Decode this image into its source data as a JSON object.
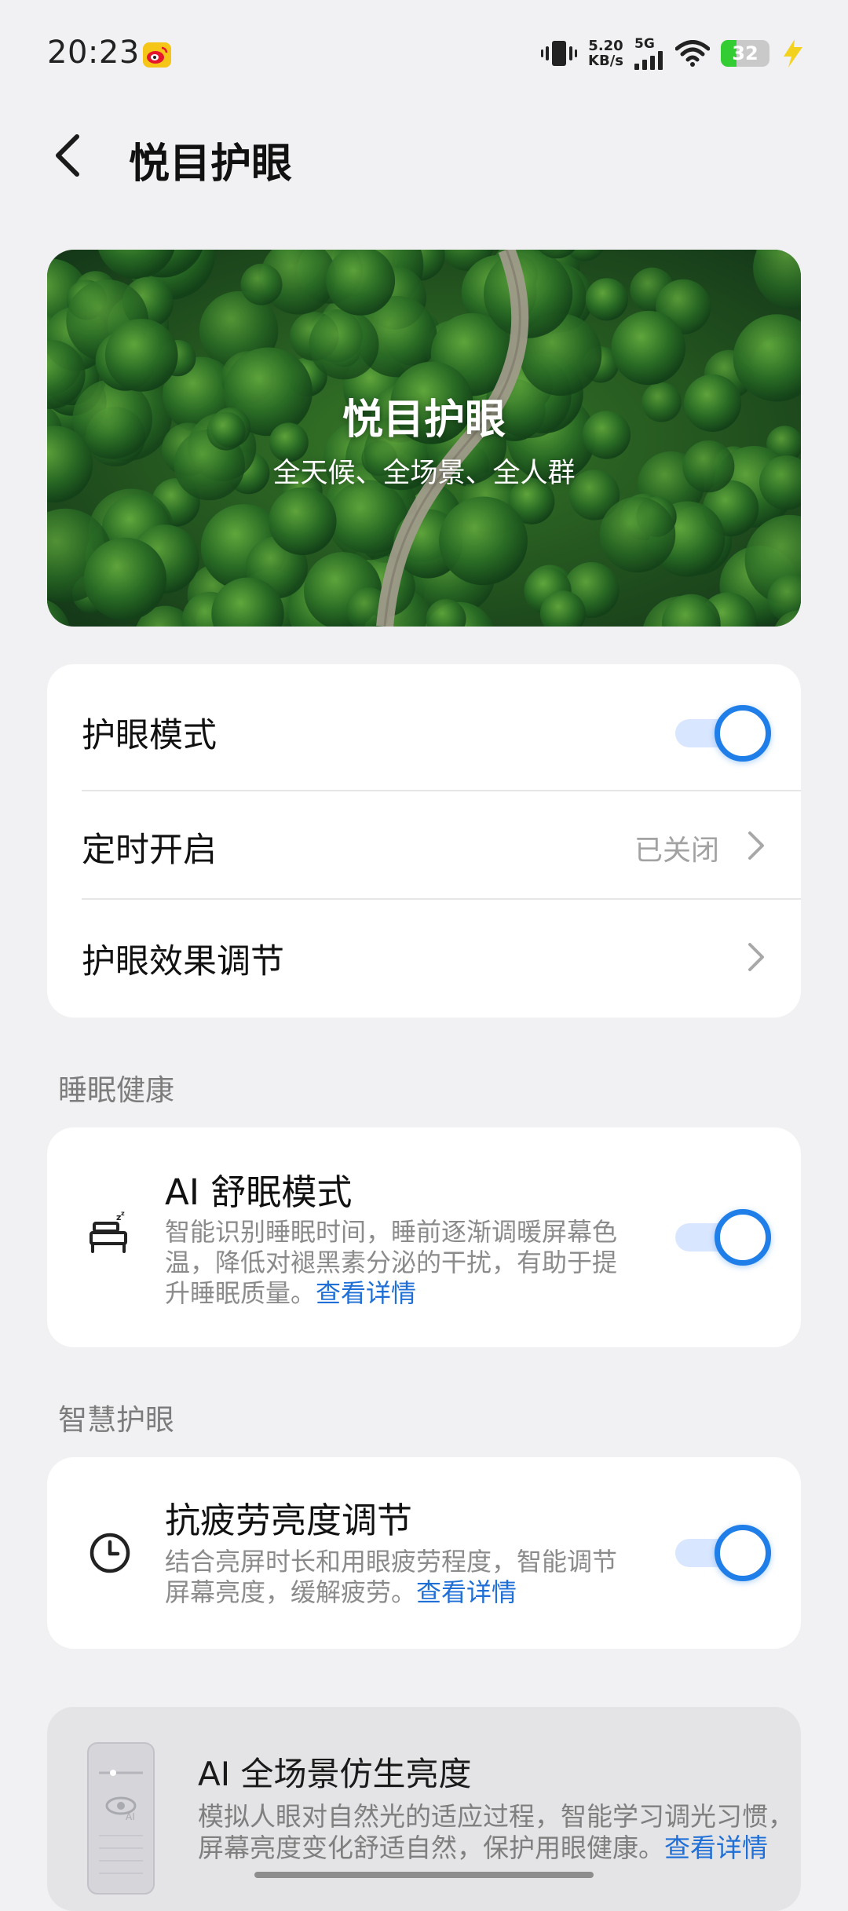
{
  "status_bar": {
    "time": "20:23",
    "net_speed_value": "5.20",
    "net_speed_unit": "KB/s",
    "network": "5G",
    "battery": "32",
    "battery_fraction": 0.32,
    "icons": [
      "weibo-icon",
      "vibrate-icon",
      "signal-icon",
      "wifi-icon",
      "battery-icon",
      "charging-icon"
    ]
  },
  "header": {
    "title": "悦目护眼"
  },
  "banner": {
    "title": "悦目护眼",
    "subtitle": "全天候、全场景、全人群"
  },
  "settings": {
    "eye_mode": {
      "label": "护眼模式",
      "on": true
    },
    "schedule": {
      "label": "定时开启",
      "value": "已关闭"
    },
    "effect": {
      "label": "护眼效果调节"
    }
  },
  "sleep_section": {
    "title": "睡眠健康",
    "item": {
      "title": "AI 舒眠模式",
      "desc": "智能识别睡眠时间，睡前逐渐调暖屏幕色温，降低对褪黑素分泌的干扰，有助于提升睡眠质量。",
      "link": "查看详情",
      "on": true
    }
  },
  "smart_section": {
    "title": "智慧护眼",
    "item": {
      "title": "抗疲劳亮度调节",
      "desc": "结合亮屏时长和用眼疲劳程度，智能调节屏幕亮度，缓解疲劳。",
      "link": "查看详情",
      "on": true
    }
  },
  "promo": {
    "title": "AI 全场景仿生亮度",
    "desc": "模拟人眼对自然光的适应过程，智能学习调光习惯，屏幕亮度变化舒适自然，保护用眼健康。",
    "link": "查看详情"
  },
  "colors": {
    "accent": "#1f7ee8",
    "link": "#1f6fd6",
    "background": "#f1f1f3",
    "card": "#ffffff"
  }
}
